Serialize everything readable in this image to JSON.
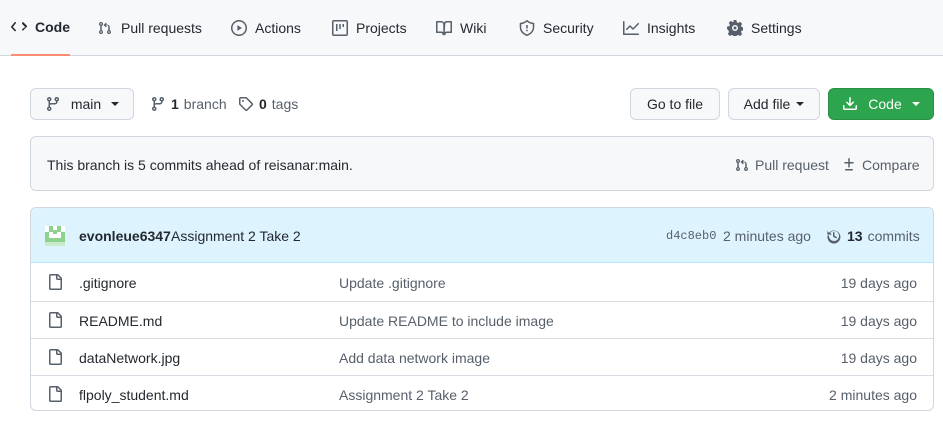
{
  "nav": {
    "tabs": [
      {
        "label": "Code",
        "icon": "code-icon",
        "active": true
      },
      {
        "label": "Pull requests",
        "icon": "pull-request-icon"
      },
      {
        "label": "Actions",
        "icon": "play-icon"
      },
      {
        "label": "Projects",
        "icon": "project-icon"
      },
      {
        "label": "Wiki",
        "icon": "book-icon"
      },
      {
        "label": "Security",
        "icon": "shield-icon"
      },
      {
        "label": "Insights",
        "icon": "graph-icon"
      },
      {
        "label": "Settings",
        "icon": "gear-icon"
      }
    ]
  },
  "toolbar": {
    "branch_label": "main",
    "branch_count": "1",
    "branch_word": "branch",
    "tag_count": "0",
    "tag_word": "tags",
    "go_to_file": "Go to file",
    "add_file": "Add file",
    "code": "Code"
  },
  "ahead": {
    "text": "This branch is 5 commits ahead of reisanar:main.",
    "pull_request": "Pull request",
    "compare": "Compare"
  },
  "latest_commit": {
    "author": "evonleue6347",
    "message": "Assignment 2 Take 2",
    "sha": "d4c8eb0",
    "time": "2 minutes ago",
    "commit_count": "13",
    "commit_word": "commits"
  },
  "files": [
    {
      "name": ".gitignore",
      "message": "Update .gitignore",
      "age": "19 days ago"
    },
    {
      "name": "README.md",
      "message": "Update README to include image",
      "age": "19 days ago"
    },
    {
      "name": "dataNetwork.jpg",
      "message": "Add data network image",
      "age": "19 days ago"
    },
    {
      "name": "flpoly_student.md",
      "message": "Assignment 2 Take 2",
      "age": "2 minutes ago"
    }
  ],
  "colors": {
    "accent_green": "#2da44e",
    "active_tab_underline": "#fd8c73",
    "commit_header_bg": "#ddf4ff"
  }
}
